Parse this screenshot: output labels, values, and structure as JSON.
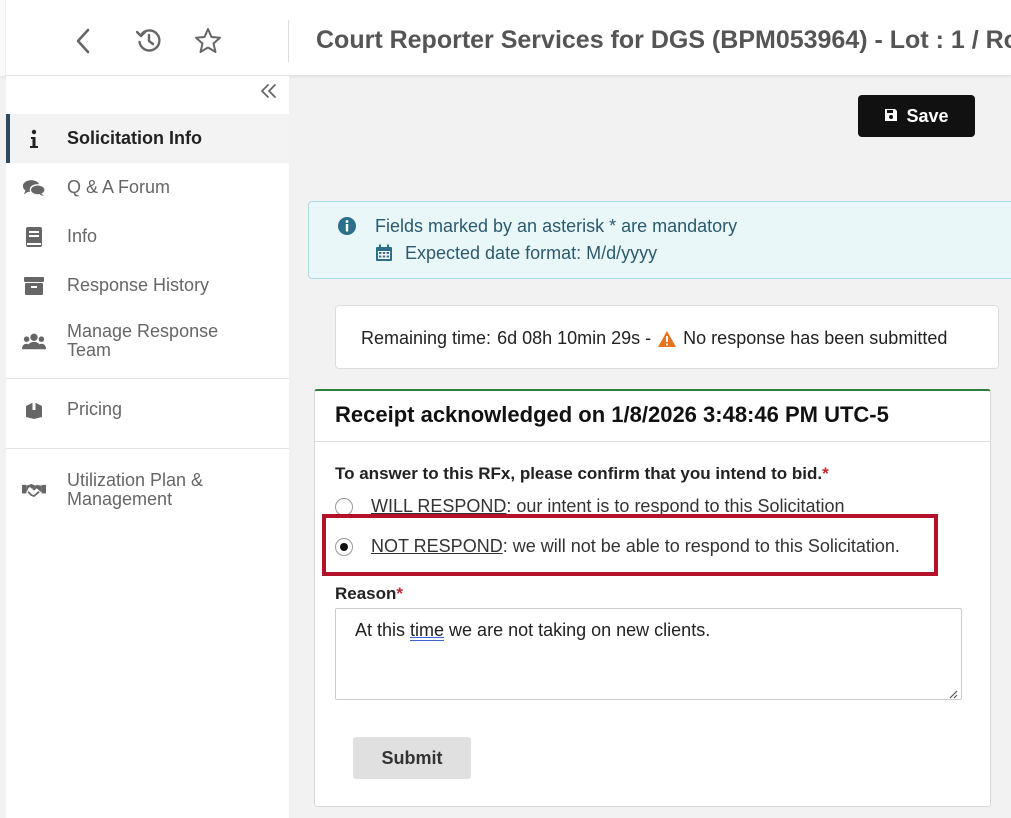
{
  "header": {
    "title": "Court Reporter Services for DGS (BPM053964) - Lot : 1 / Ro",
    "back_icon": "chevron-left-icon",
    "history_icon": "history-icon",
    "favorite_icon": "star-icon"
  },
  "sidebar": {
    "collapse_icon": "double-chevron-left-icon",
    "items": [
      {
        "label": "Solicitation Info",
        "icon": "info-icon",
        "active": true
      },
      {
        "label": "Q & A Forum",
        "icon": "comments-icon"
      },
      {
        "label": "Info",
        "icon": "book-icon"
      },
      {
        "label": "Response History",
        "icon": "archive-icon"
      },
      {
        "label_line1": "Manage Response",
        "label_line2": "Team",
        "icon": "users-icon"
      },
      {
        "label": "Pricing",
        "icon": "box-icon"
      },
      {
        "label_line1": "Utilization Plan &",
        "label_line2": "Management",
        "icon": "handshake-icon"
      }
    ]
  },
  "toolbar": {
    "save_label": "Save"
  },
  "info": {
    "mandatory_text": "Fields marked by an asterisk * are mandatory",
    "date_format_text": "Expected date format: M/d/yyyy"
  },
  "remaining": {
    "label": "Remaining time:",
    "value": "6d 08h 10min 29s -",
    "status": "No response has been submitted"
  },
  "card": {
    "title": "Receipt acknowledged on 1/8/2026 3:48:46 PM UTC-5",
    "question": "To answer to this RFx, please confirm that you intend to bid.",
    "required_mark": "*",
    "option1_key": "WILL RESPOND",
    "option1_rest": ": our intent is to respond to this Solicitation",
    "option2_key": "NOT RESPOND",
    "option2_rest": ": we will not be able to respond to this Solicitation.",
    "selected": "NOT RESPOND",
    "reason_label": "Reason",
    "reason_pre": "At this ",
    "reason_spell": "time",
    "reason_post": " we are not taking on new clients.",
    "submit_label": "Submit"
  },
  "colors": {
    "accent_dark": "#111111",
    "highlight": "#b5112b",
    "card_top": "#2f7f3d",
    "info_bg": "#eaf7f8",
    "warning": "#e8731c"
  }
}
